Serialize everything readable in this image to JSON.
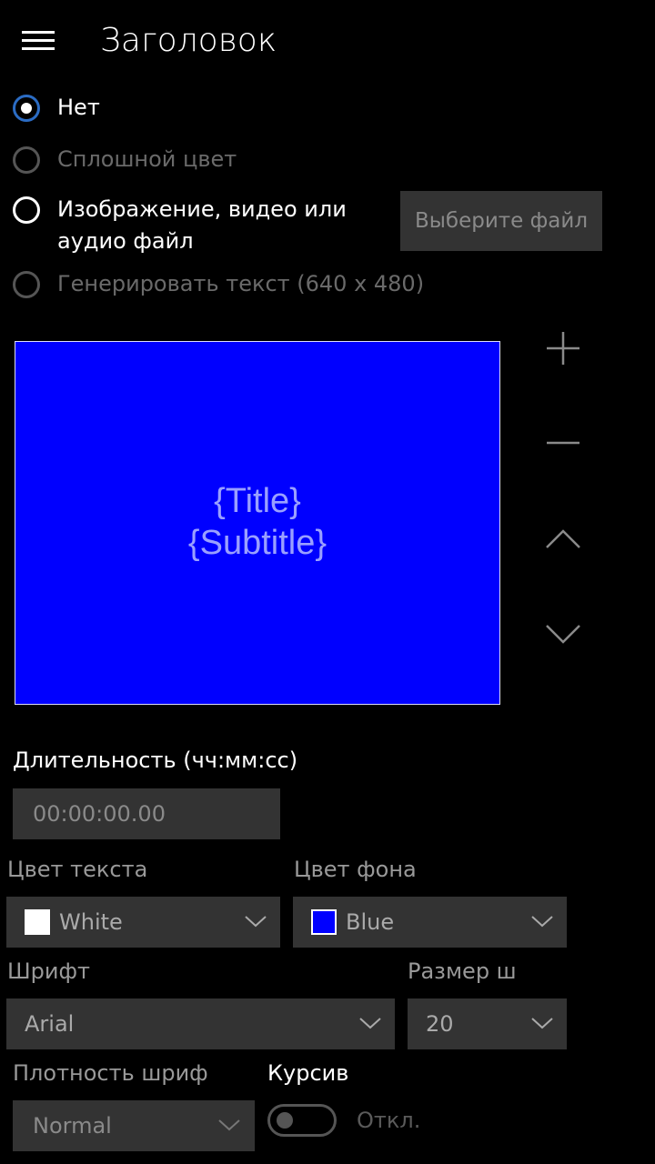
{
  "header": {
    "title": "Заголовок"
  },
  "radio_options": [
    {
      "label": "Нет",
      "state": "selected"
    },
    {
      "label": "Сплошной цвет",
      "state": "disabled"
    },
    {
      "label_line1": "Изображение, видео или",
      "label_line2": "аудио файл",
      "state": "unselected"
    },
    {
      "label": "Генерировать текст (640 x 480)",
      "state": "disabled"
    }
  ],
  "choose_file_button": "Выберите файл",
  "preview": {
    "title_placeholder": "{Title}",
    "subtitle_placeholder": "{Subtitle}",
    "background_color": "#0000ff"
  },
  "side_icons": [
    "plus-icon",
    "minus-icon",
    "chevron-up-icon",
    "chevron-down-icon"
  ],
  "duration": {
    "label": "Длительность (чч:мм:сс)",
    "value": "00:00:00.00"
  },
  "text_color": {
    "label": "Цвет текста",
    "value": "White",
    "swatch": "#ffffff"
  },
  "background_color": {
    "label": "Цвет фона",
    "value": "Blue",
    "swatch": "#0000ff"
  },
  "font": {
    "label": "Шрифт",
    "value": "Arial"
  },
  "font_size": {
    "label": "Размер шр",
    "value": "20"
  },
  "font_weight": {
    "label": "Плотность шрифт",
    "value": "Normal"
  },
  "italic": {
    "label": "Курсив",
    "state_label": "Откл.",
    "on": false
  }
}
